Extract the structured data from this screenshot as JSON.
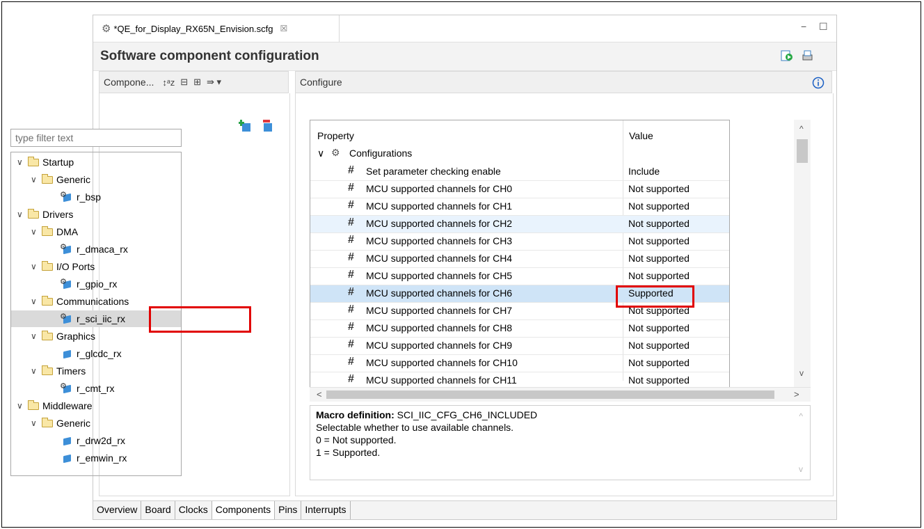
{
  "tab": {
    "title": "*QE_for_Display_RX65N_Envision.scfg",
    "close": "☒"
  },
  "window_controls": {
    "minimize": "−",
    "maximize": "☐"
  },
  "header": {
    "title": "Software component configuration"
  },
  "left_panel": {
    "title": "Compone...",
    "filter_placeholder": "type filter text",
    "tree": [
      {
        "label": "Startup",
        "type": "folder",
        "level": 0
      },
      {
        "label": "Generic",
        "type": "folder",
        "level": 1
      },
      {
        "label": "r_bsp",
        "type": "component",
        "level": 2
      },
      {
        "label": "Drivers",
        "type": "folder",
        "level": 0
      },
      {
        "label": "DMA",
        "type": "folder",
        "level": 1
      },
      {
        "label": "r_dmaca_rx",
        "type": "component",
        "level": 2
      },
      {
        "label": "I/O Ports",
        "type": "folder",
        "level": 1
      },
      {
        "label": "r_gpio_rx",
        "type": "component",
        "level": 2
      },
      {
        "label": "Communications",
        "type": "folder",
        "level": 1
      },
      {
        "label": "r_sci_iic_rx",
        "type": "component",
        "level": 2,
        "selected": true
      },
      {
        "label": "Graphics",
        "type": "folder",
        "level": 1
      },
      {
        "label": "r_glcdc_rx",
        "type": "component",
        "level": 2
      },
      {
        "label": "Timers",
        "type": "folder",
        "level": 1
      },
      {
        "label": "r_cmt_rx",
        "type": "component",
        "level": 2
      },
      {
        "label": "Middleware",
        "type": "folder",
        "level": 0
      },
      {
        "label": "Generic",
        "type": "folder",
        "level": 1
      },
      {
        "label": "r_drw2d_rx",
        "type": "component",
        "level": 2
      },
      {
        "label": "r_emwin_rx",
        "type": "component",
        "level": 2
      }
    ]
  },
  "right_panel": {
    "title": "Configure",
    "grid": {
      "col_property": "Property",
      "col_value": "Value",
      "group": "Configurations",
      "rows": [
        {
          "property": "Set parameter checking enable",
          "value": "Include"
        },
        {
          "property": "MCU supported channels for CH0",
          "value": "Not supported"
        },
        {
          "property": "MCU supported channels for CH1",
          "value": "Not supported"
        },
        {
          "property": "MCU supported channels for CH2",
          "value": "Not supported"
        },
        {
          "property": "MCU supported channels for CH3",
          "value": "Not supported"
        },
        {
          "property": "MCU supported channels for CH4",
          "value": "Not supported"
        },
        {
          "property": "MCU supported channels for CH5",
          "value": "Not supported"
        },
        {
          "property": "MCU supported channels for CH6",
          "value": "Supported"
        },
        {
          "property": "MCU supported channels for CH7",
          "value": "Not supported"
        },
        {
          "property": "MCU supported channels for CH8",
          "value": "Not supported"
        },
        {
          "property": "MCU supported channels for CH9",
          "value": "Not supported"
        },
        {
          "property": "MCU supported channels for CH10",
          "value": "Not supported"
        },
        {
          "property": "MCU supported channels for CH11",
          "value": "Not supported"
        }
      ]
    },
    "description": {
      "label": "Macro definition:",
      "macro": "SCI_IIC_CFG_CH6_INCLUDED",
      "line1": "Selectable whether to use available channels.",
      "line2": "0 = Not supported.",
      "line3": "1 = Supported."
    }
  },
  "bottom_tabs": [
    "Overview",
    "Board",
    "Clocks",
    "Components",
    "Pins",
    "Interrupts"
  ],
  "icons": {
    "generic": "#",
    "group": "⚙",
    "scroll_up": "^",
    "scroll_down": "v",
    "scroll_left": "<",
    "scroll_right": ">"
  },
  "colors": {
    "highlight": "#e10000",
    "selected_row": "#cfe4f7",
    "row_hover": "#e9f3fd",
    "info": "#1a5fc4"
  }
}
